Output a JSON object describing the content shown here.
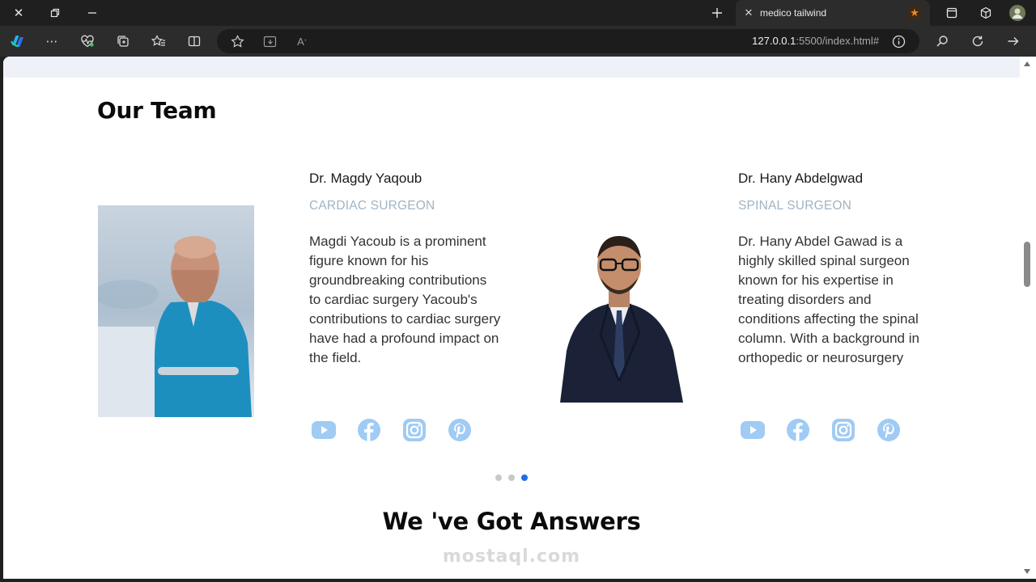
{
  "browser": {
    "tab_title": "medico tailwind",
    "url_host": "127.0.0.1",
    "url_rest": ":5500/index.html#"
  },
  "team": {
    "title": "Our Team",
    "members": [
      {
        "name": "Dr. Magdy Yaqoub",
        "role": "CARDIAC SURGEON",
        "bio": "Magdi Yacoub is a prominent figure known for his groundbreaking contributions to cardiac surgery Yacoub's contributions to cardiac surgery have had a profound impact on the field."
      },
      {
        "name": "Dr. Hany Abdelgwad",
        "role": "SPINAL SURGEON",
        "bio": "Dr. Hany Abdel Gawad is a highly skilled spinal surgeon known for his expertise in treating disorders and conditions affecting the spinal column. With a background in orthopedic or neurosurgery"
      }
    ],
    "social_icons": [
      "youtube-icon",
      "facebook-icon",
      "instagram-icon",
      "pinterest-icon"
    ],
    "carousel": {
      "pages": 3,
      "active": 3
    }
  },
  "faq": {
    "title": "We 've Got Answers"
  },
  "watermark": {
    "text": "mostaql.com"
  },
  "colors": {
    "accent": "#1e6ee8",
    "social": "#9fcbf4",
    "role": "#9fb4c6"
  }
}
